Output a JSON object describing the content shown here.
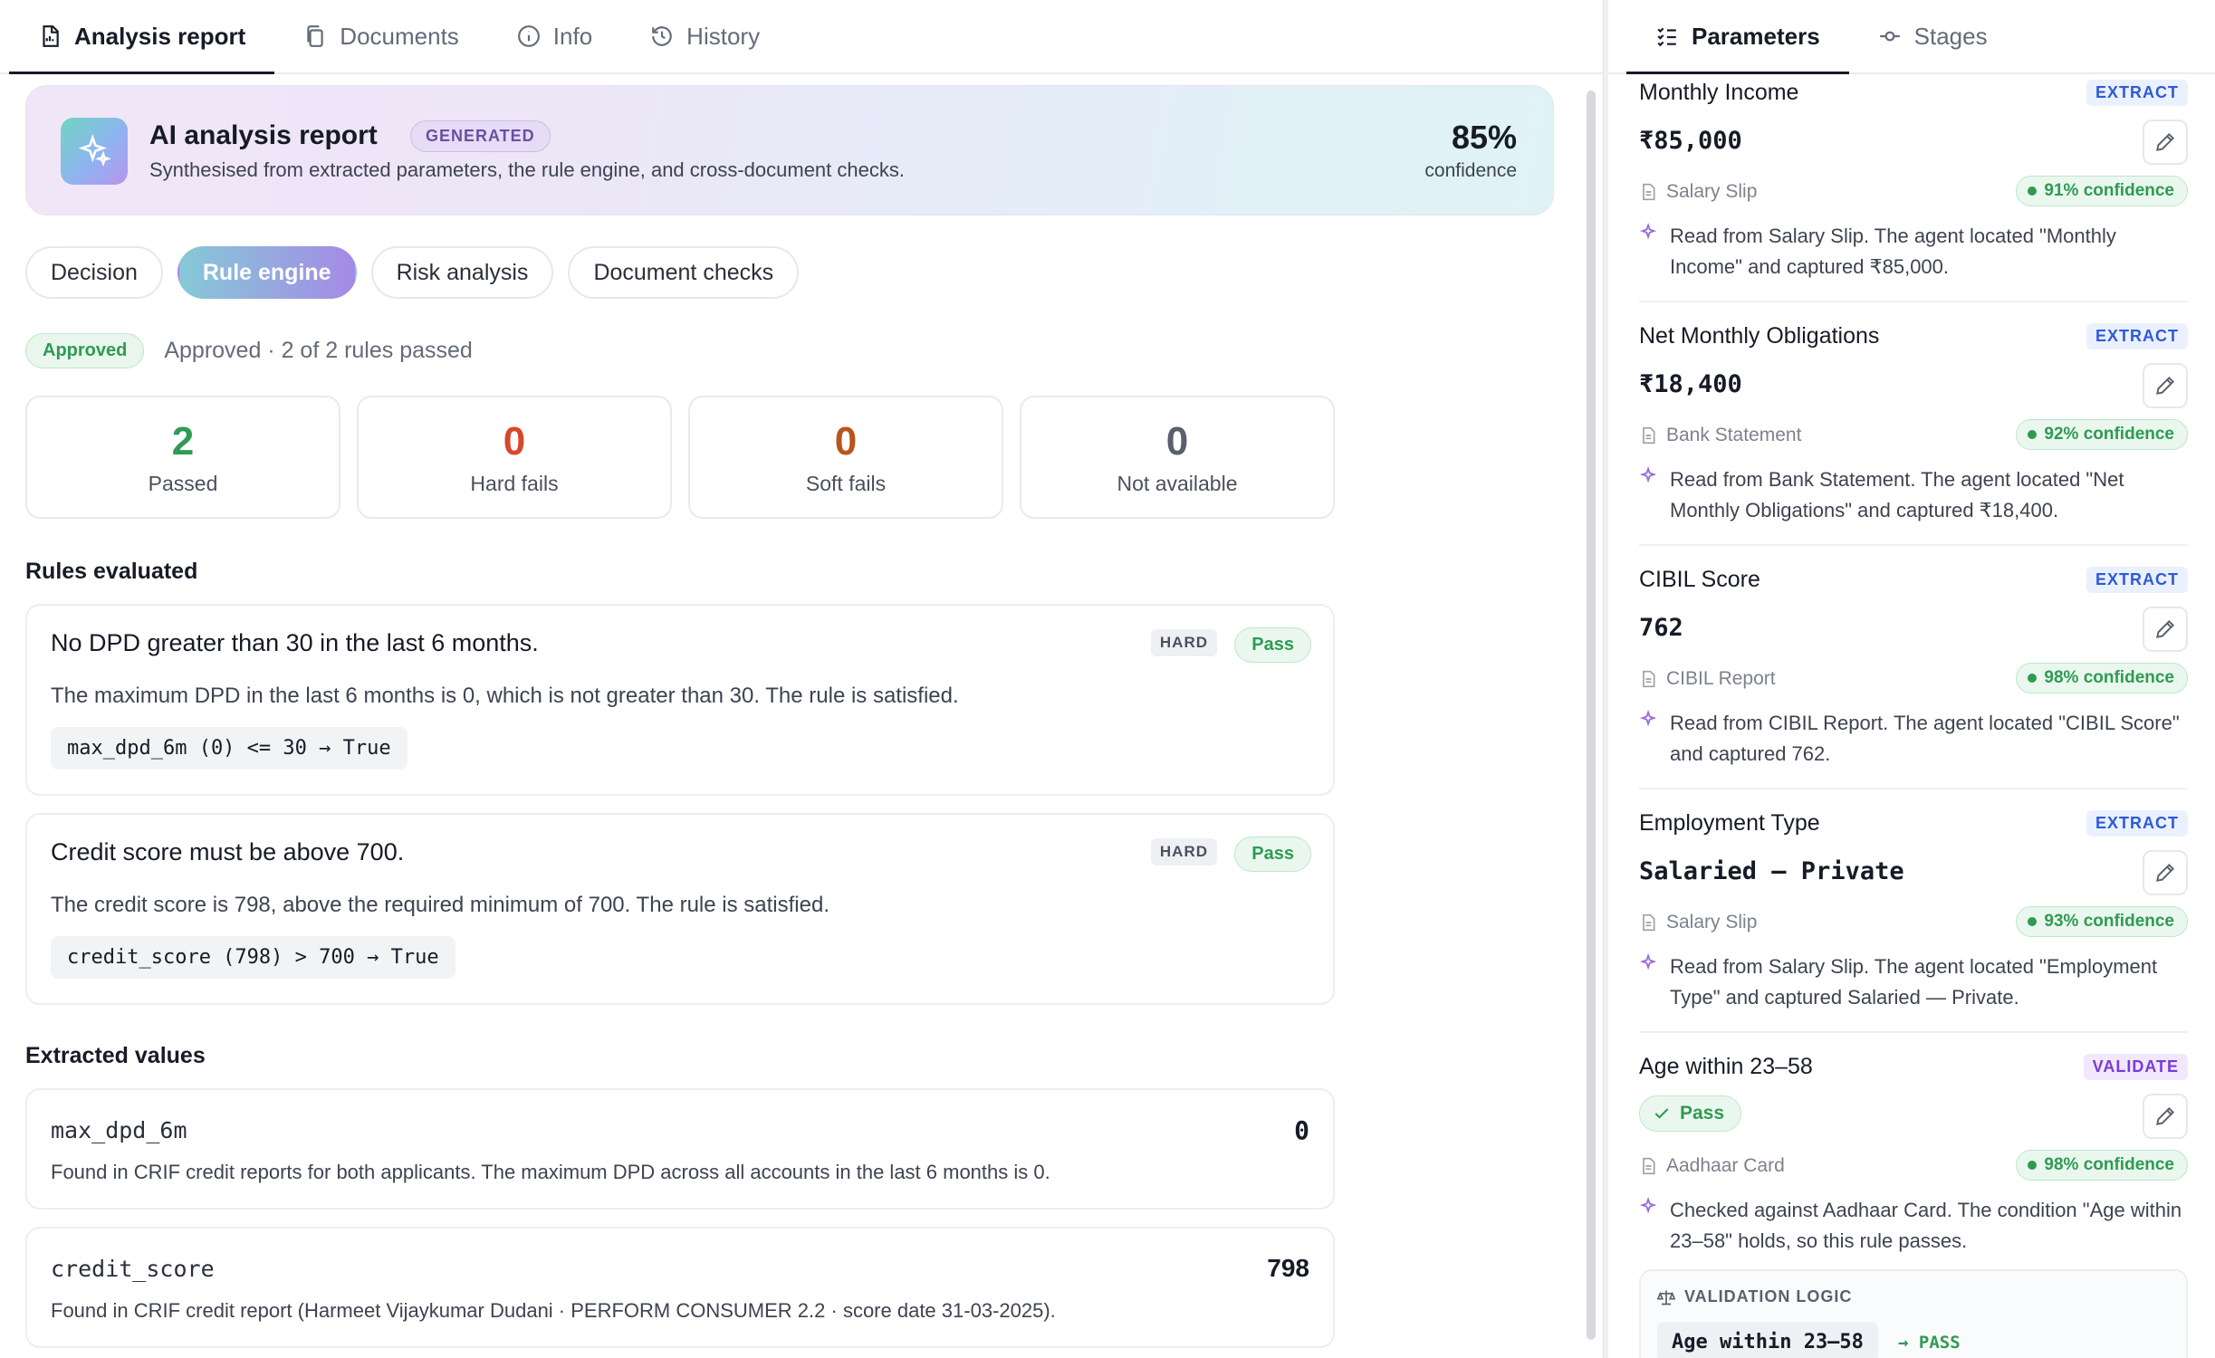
{
  "left_tabs": [
    {
      "label": "Analysis report"
    },
    {
      "label": "Documents"
    },
    {
      "label": "Info"
    },
    {
      "label": "History"
    }
  ],
  "report": {
    "title": "AI analysis report",
    "badge": "GENERATED",
    "subtitle": "Synthesised from extracted parameters, the rule engine, and cross-document checks.",
    "confidence_pct": "85%",
    "confidence_label": "confidence"
  },
  "section_tabs": [
    {
      "label": "Decision"
    },
    {
      "label": "Rule engine"
    },
    {
      "label": "Risk analysis"
    },
    {
      "label": "Document checks"
    }
  ],
  "status": {
    "badge": "Approved",
    "text": "Approved · 2 of 2 rules passed"
  },
  "stats": [
    {
      "value": "2",
      "label": "Passed",
      "color": "#2f9b52"
    },
    {
      "value": "0",
      "label": "Hard fails",
      "color": "#d6482b"
    },
    {
      "value": "0",
      "label": "Soft fails",
      "color": "#b8551c"
    },
    {
      "value": "0",
      "label": "Not available",
      "color": "#5a606c"
    }
  ],
  "rules_title": "Rules evaluated",
  "rules": [
    {
      "title": "No DPD greater than 30 in the last 6 months.",
      "severity": "HARD",
      "result": "Pass",
      "description": "The maximum DPD in the last 6 months is 0, which is not greater than 30. The rule is satisfied.",
      "code": "max_dpd_6m (0) <= 30 → True"
    },
    {
      "title": "Credit score must be above 700.",
      "severity": "HARD",
      "result": "Pass",
      "description": "The credit score is 798, above the required minimum of 700. The rule is satisfied.",
      "code": "credit_score (798) > 700 → True"
    }
  ],
  "extracted_title": "Extracted values",
  "extracted": [
    {
      "key": "max_dpd_6m",
      "value": "0",
      "description": "Found in CRIF credit reports for both applicants. The maximum DPD across all accounts in the last 6 months is 0."
    },
    {
      "key": "credit_score",
      "value": "798",
      "description": "Found in CRIF credit report (Harmeet Vijaykumar Dudani · PERFORM CONSUMER 2.2 · score date 31-03-2025)."
    }
  ],
  "right_tabs": [
    {
      "label": "Parameters"
    },
    {
      "label": "Stages"
    }
  ],
  "parameters": [
    {
      "name": "Monthly Income",
      "kind": "EXTRACT",
      "value": "₹85,000",
      "source": "Salary Slip",
      "confidence": "91% confidence",
      "note": "Read from Salary Slip. The agent located \"Monthly Income\" and captured ₹85,000."
    },
    {
      "name": "Net Monthly Obligations",
      "kind": "EXTRACT",
      "value": "₹18,400",
      "source": "Bank Statement",
      "confidence": "92% confidence",
      "note": "Read from Bank Statement. The agent located \"Net Monthly Obligations\" and captured ₹18,400."
    },
    {
      "name": "CIBIL Score",
      "kind": "EXTRACT",
      "value": "762",
      "source": "CIBIL Report",
      "confidence": "98% confidence",
      "note": "Read from CIBIL Report. The agent located \"CIBIL Score\" and captured 762."
    },
    {
      "name": "Employment Type",
      "kind": "EXTRACT",
      "value": "Salaried — Private",
      "source": "Salary Slip",
      "confidence": "93% confidence",
      "note": "Read from Salary Slip. The agent located \"Employment Type\" and captured Salaried — Private."
    },
    {
      "name": "Age within 23–58",
      "kind": "VALIDATE",
      "result": "Pass",
      "source": "Aadhaar Card",
      "confidence": "98% confidence",
      "note": "Checked against Aadhaar Card. The condition \"Age within 23–58\" holds, so this rule passes."
    }
  ],
  "validation_logic": {
    "title": "VALIDATION LOGIC",
    "code": "Age within 23–58",
    "result": "→ PASS"
  }
}
